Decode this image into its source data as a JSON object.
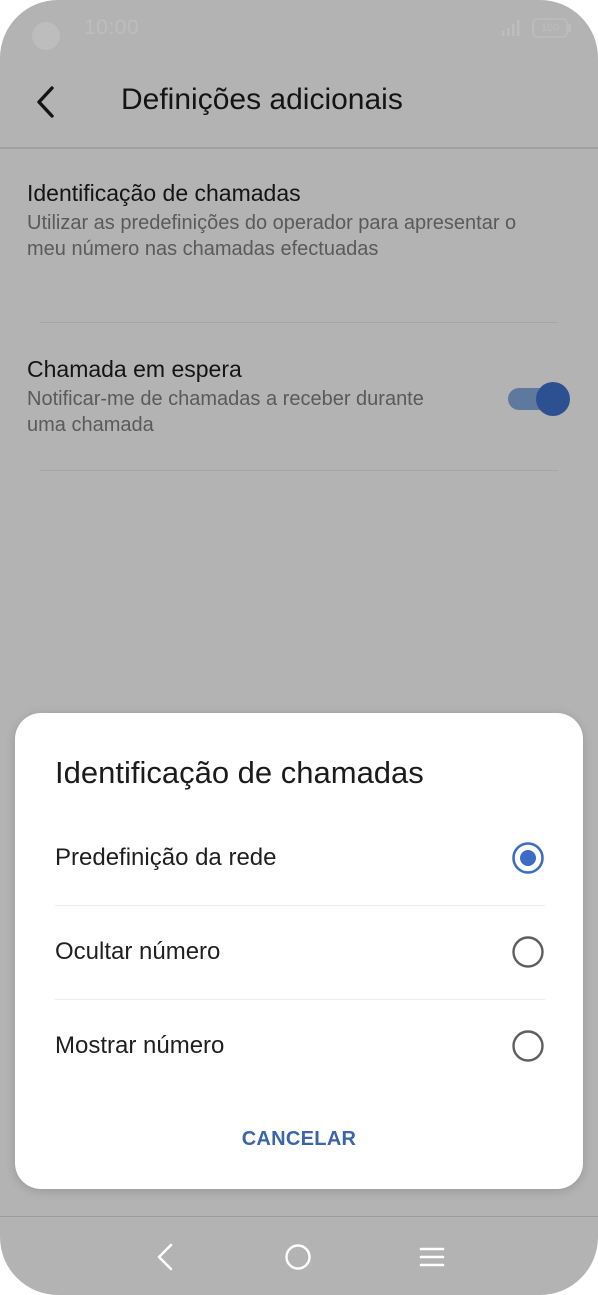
{
  "status_bar": {
    "time": "10:00",
    "battery": "100",
    "signal_icon": "signal-bars-icon",
    "battery_icon": "battery-icon"
  },
  "header": {
    "title": "Definições adicionais",
    "back_icon": "back-arrow-icon"
  },
  "settings": [
    {
      "title": "Identificação de chamadas",
      "description": "Utilizar as predefinições do operador para apresentar o meu número nas chamadas efectuadas"
    },
    {
      "title": "Chamada em espera",
      "description": "Notificar-me de chamadas a receber durante uma chamada",
      "toggle_on": true
    }
  ],
  "dialog": {
    "title": "Identificação de chamadas",
    "options": [
      {
        "label": "Predefinição da rede",
        "selected": true
      },
      {
        "label": "Ocultar número",
        "selected": false
      },
      {
        "label": "Mostrar número",
        "selected": false
      }
    ],
    "cancel_label": "CANCELAR"
  },
  "colors": {
    "accent": "#3d6cc4",
    "cancel_text": "#3c65a8",
    "toggle_track": "#7fa3d6",
    "radio_unselected": "#5f5f5f"
  },
  "nav_bar": {
    "back_icon": "nav-back-icon",
    "home_icon": "nav-home-icon",
    "menu_icon": "nav-menu-icon"
  }
}
